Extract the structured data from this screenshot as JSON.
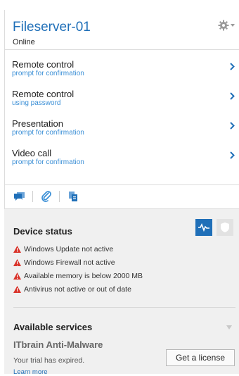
{
  "header": {
    "device_name": "Fileserver-01",
    "device_state": "Online",
    "settings_icon": "gear-icon"
  },
  "actions": [
    {
      "title": "Remote control",
      "subtitle": "prompt for confirmation"
    },
    {
      "title": "Remote control",
      "subtitle": "using password"
    },
    {
      "title": "Presentation",
      "subtitle": "prompt for confirmation"
    },
    {
      "title": "Video call",
      "subtitle": "prompt for confirmation"
    }
  ],
  "toolbar": {
    "icons": [
      "chat-icon",
      "attachment-icon",
      "copy-icon"
    ]
  },
  "device_status": {
    "title": "Device status",
    "items": [
      "Windows Update not active",
      "Windows Firewall not active",
      "Available memory is below 2000 MB",
      "Antivirus not active or out of date"
    ]
  },
  "services": {
    "title": "Available services",
    "service_name": "ITbrain Anti-Malware",
    "note": "Your trial has expired.",
    "license_label": "Get a license",
    "learn_more": "Learn more"
  },
  "colors": {
    "accent": "#1f6fb8",
    "subtitle": "#3b8fd6",
    "warning": "#d9342b",
    "status_bg": "#f0f0f0"
  }
}
